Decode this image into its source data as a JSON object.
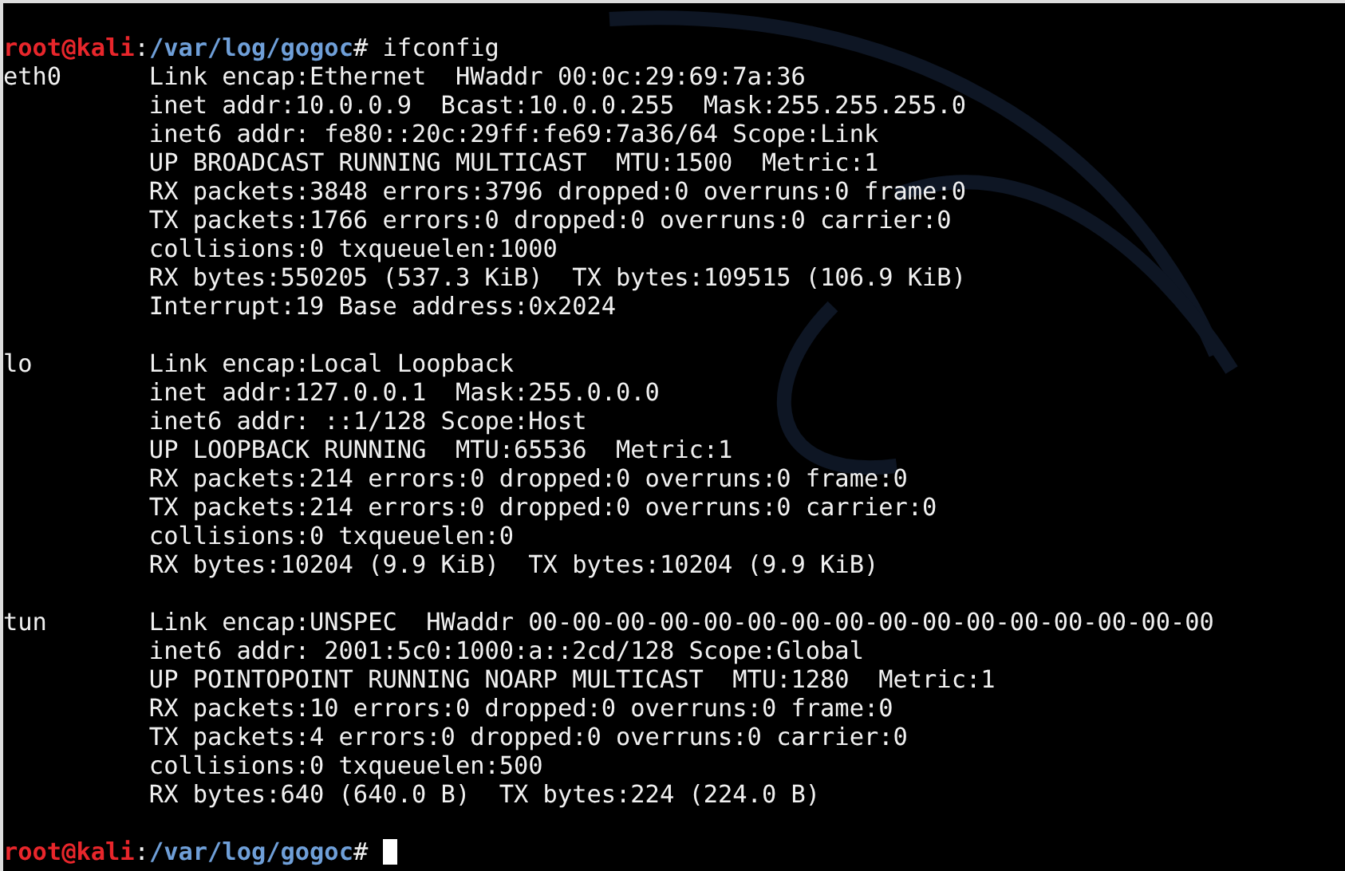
{
  "terminal": {
    "prompt": {
      "user_host": "root@kali",
      "separator": ":",
      "path": "/var/log/gogoc",
      "symbol": "#",
      "command": "ifconfig"
    },
    "interfaces": [
      {
        "name": "eth0",
        "lines": [
          "Link encap:Ethernet  HWaddr 00:0c:29:69:7a:36",
          "inet addr:10.0.0.9  Bcast:10.0.0.255  Mask:255.255.255.0",
          "inet6 addr: fe80::20c:29ff:fe69:7a36/64 Scope:Link",
          "UP BROADCAST RUNNING MULTICAST  MTU:1500  Metric:1",
          "RX packets:3848 errors:3796 dropped:0 overruns:0 frame:0",
          "TX packets:1766 errors:0 dropped:0 overruns:0 carrier:0",
          "collisions:0 txqueuelen:1000",
          "RX bytes:550205 (537.3 KiB)  TX bytes:109515 (106.9 KiB)",
          "Interrupt:19 Base address:0x2024"
        ]
      },
      {
        "name": "lo",
        "lines": [
          "Link encap:Local Loopback",
          "inet addr:127.0.0.1  Mask:255.0.0.0",
          "inet6 addr: ::1/128 Scope:Host",
          "UP LOOPBACK RUNNING  MTU:65536  Metric:1",
          "RX packets:214 errors:0 dropped:0 overruns:0 frame:0",
          "TX packets:214 errors:0 dropped:0 overruns:0 carrier:0",
          "collisions:0 txqueuelen:0",
          "RX bytes:10204 (9.9 KiB)  TX bytes:10204 (9.9 KiB)"
        ]
      },
      {
        "name": "tun",
        "lines": [
          "Link encap:UNSPEC  HWaddr 00-00-00-00-00-00-00-00-00-00-00-00-00-00-00-00",
          "inet6 addr: 2001:5c0:1000:a::2cd/128 Scope:Global",
          "UP POINTOPOINT RUNNING NOARP MULTICAST  MTU:1280  Metric:1",
          "RX packets:10 errors:0 dropped:0 overruns:0 frame:0",
          "TX packets:4 errors:0 dropped:0 overruns:0 carrier:0",
          "collisions:0 txqueuelen:500",
          "RX bytes:640 (640.0 B)  TX bytes:224 (224.0 B)"
        ]
      }
    ],
    "final_prompt": {
      "user_host": "root@kali",
      "separator": ":",
      "path": "/var/log/gogoc",
      "symbol": "#"
    }
  }
}
